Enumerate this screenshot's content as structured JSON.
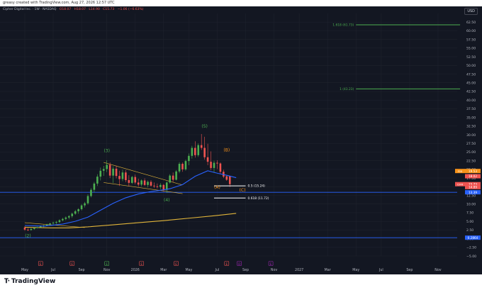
{
  "attribution": "greasy created with TradingView.com, Aug 27, 2026 12:57 UTC",
  "legend": {
    "symbol": "Cipher Digital Inc. · 1W · NASDAQ",
    "o": "O18.07",
    "h": "H18.07",
    "l": "L14.90",
    "c": "C15.73",
    "chg": "−1.06 (−6.63%)"
  },
  "currency": "USD",
  "brand": "TradingView",
  "colors": {
    "background": "#131722",
    "grid": "#1e222d",
    "up": "#26a69a",
    "up_green": "#4caf50",
    "down": "#ef5350",
    "ema_fast": "#2962ff",
    "ema_slow": "#e0b43a",
    "trendline": "#e0b43a",
    "fib_target": "#4caf50",
    "level_line": "#2962ff",
    "wave_impulse": "#4caf50",
    "wave_corrective": "#f7931a"
  },
  "chart_data": {
    "type": "candlestick",
    "y_axis": {
      "min": -5,
      "max": 65,
      "ticks": [
        -5,
        -2.5,
        0,
        2.5,
        5,
        7.5,
        10,
        12.5,
        15,
        17.5,
        20,
        22.5,
        25,
        27.5,
        30,
        32.5,
        35,
        37.5,
        40,
        42.5,
        45,
        47.5,
        50,
        52.5,
        55,
        57.5,
        60,
        62.5
      ],
      "tick_labels": [
        "−5.00",
        "−2.50",
        "0.00",
        "2.50",
        "5.00",
        "7.50",
        "10.00",
        "12.50",
        "15.00",
        "17.50",
        "20.00",
        "22.50",
        "25.00",
        "27.50",
        "30.00",
        "32.50",
        "35.00",
        "37.50",
        "40.00",
        "42.50",
        "45.00",
        "47.50",
        "50.00",
        "52.50",
        "55.00",
        "57.50",
        "60.00",
        "62.50"
      ],
      "scale": "linear",
      "position": "right"
    },
    "x_axis": {
      "ticks": [
        {
          "label": "May",
          "week": 0
        },
        {
          "label": "Jul",
          "week": 9
        },
        {
          "label": "Sep",
          "week": 18
        },
        {
          "label": "Nov",
          "week": 26
        },
        {
          "label": "2026",
          "week": 35
        },
        {
          "label": "Mar",
          "week": 44
        },
        {
          "label": "May",
          "week": 52
        },
        {
          "label": "Jul",
          "week": 61
        },
        {
          "label": "Sep",
          "week": 70
        },
        {
          "label": "Nov",
          "week": 79
        },
        {
          "label": "2027",
          "week": 87
        },
        {
          "label": "Mar",
          "week": 96
        },
        {
          "label": "May",
          "week": 105
        },
        {
          "label": "Jul",
          "week": 113
        },
        {
          "label": "Sep",
          "week": 122
        },
        {
          "label": "Nov",
          "week": 131
        }
      ]
    },
    "candles": [
      {
        "o": 3.2,
        "h": 3.6,
        "l": 2.3,
        "c": 2.6
      },
      {
        "o": 2.6,
        "h": 3.1,
        "l": 2.2,
        "c": 2.5
      },
      {
        "o": 2.5,
        "h": 3.0,
        "l": 2.3,
        "c": 2.8
      },
      {
        "o": 2.8,
        "h": 3.3,
        "l": 2.6,
        "c": 3.1
      },
      {
        "o": 3.1,
        "h": 3.5,
        "l": 2.9,
        "c": 3.3
      },
      {
        "o": 3.3,
        "h": 3.8,
        "l": 3.1,
        "c": 3.6
      },
      {
        "o": 3.6,
        "h": 4.0,
        "l": 3.3,
        "c": 3.8
      },
      {
        "o": 3.8,
        "h": 4.3,
        "l": 3.6,
        "c": 4.1
      },
      {
        "o": 4.1,
        "h": 4.6,
        "l": 3.8,
        "c": 4.4
      },
      {
        "o": 4.4,
        "h": 4.9,
        "l": 4.0,
        "c": 4.6
      },
      {
        "o": 4.6,
        "h": 5.1,
        "l": 4.2,
        "c": 4.8
      },
      {
        "o": 4.8,
        "h": 5.6,
        "l": 4.5,
        "c": 5.3
      },
      {
        "o": 5.3,
        "h": 6.0,
        "l": 5.0,
        "c": 5.7
      },
      {
        "o": 5.7,
        "h": 6.4,
        "l": 5.3,
        "c": 6.1
      },
      {
        "o": 6.1,
        "h": 6.8,
        "l": 5.6,
        "c": 6.5
      },
      {
        "o": 6.5,
        "h": 7.5,
        "l": 6.0,
        "c": 7.2
      },
      {
        "o": 7.2,
        "h": 8.3,
        "l": 6.9,
        "c": 7.9
      },
      {
        "o": 7.9,
        "h": 8.8,
        "l": 7.2,
        "c": 8.5
      },
      {
        "o": 8.5,
        "h": 10.0,
        "l": 8.1,
        "c": 9.6
      },
      {
        "o": 9.6,
        "h": 10.6,
        "l": 9.0,
        "c": 10.2
      },
      {
        "o": 10.2,
        "h": 12.8,
        "l": 9.8,
        "c": 12.3
      },
      {
        "o": 12.3,
        "h": 14.6,
        "l": 11.9,
        "c": 14.1
      },
      {
        "o": 14.1,
        "h": 16.4,
        "l": 13.4,
        "c": 15.9
      },
      {
        "o": 15.9,
        "h": 18.6,
        "l": 15.2,
        "c": 17.9
      },
      {
        "o": 17.9,
        "h": 20.5,
        "l": 16.8,
        "c": 19.6
      },
      {
        "o": 19.6,
        "h": 21.0,
        "l": 18.1,
        "c": 20.1
      },
      {
        "o": 20.1,
        "h": 22.6,
        "l": 19.2,
        "c": 21.3
      },
      {
        "o": 21.3,
        "h": 22.0,
        "l": 17.5,
        "c": 18.2
      },
      {
        "o": 18.2,
        "h": 20.9,
        "l": 16.0,
        "c": 20.2
      },
      {
        "o": 20.2,
        "h": 21.1,
        "l": 17.4,
        "c": 18.1
      },
      {
        "o": 18.1,
        "h": 19.6,
        "l": 15.2,
        "c": 17.2
      },
      {
        "o": 17.2,
        "h": 19.9,
        "l": 16.6,
        "c": 19.1
      },
      {
        "o": 19.1,
        "h": 19.8,
        "l": 16.3,
        "c": 16.9
      },
      {
        "o": 16.9,
        "h": 18.3,
        "l": 15.1,
        "c": 16.1
      },
      {
        "o": 16.1,
        "h": 18.1,
        "l": 15.8,
        "c": 17.8
      },
      {
        "o": 17.8,
        "h": 18.5,
        "l": 15.7,
        "c": 16.2
      },
      {
        "o": 16.2,
        "h": 17.3,
        "l": 15.0,
        "c": 15.6
      },
      {
        "o": 15.6,
        "h": 17.1,
        "l": 15.1,
        "c": 16.8
      },
      {
        "o": 16.8,
        "h": 17.4,
        "l": 15.2,
        "c": 15.5
      },
      {
        "o": 15.5,
        "h": 16.8,
        "l": 14.8,
        "c": 16.4
      },
      {
        "o": 16.4,
        "h": 16.9,
        "l": 15.0,
        "c": 15.3
      },
      {
        "o": 15.3,
        "h": 16.2,
        "l": 14.6,
        "c": 15.1
      },
      {
        "o": 15.1,
        "h": 15.9,
        "l": 14.5,
        "c": 14.9
      },
      {
        "o": 14.9,
        "h": 16.0,
        "l": 14.3,
        "c": 15.5
      },
      {
        "o": 15.5,
        "h": 15.8,
        "l": 13.6,
        "c": 14.1
      },
      {
        "o": 14.1,
        "h": 16.5,
        "l": 13.2,
        "c": 16.2
      },
      {
        "o": 16.2,
        "h": 18.6,
        "l": 15.9,
        "c": 18.2
      },
      {
        "o": 18.2,
        "h": 19.1,
        "l": 16.4,
        "c": 17.0
      },
      {
        "o": 17.0,
        "h": 19.8,
        "l": 16.8,
        "c": 19.4
      },
      {
        "o": 19.4,
        "h": 22.1,
        "l": 18.9,
        "c": 21.6
      },
      {
        "o": 21.6,
        "h": 22.0,
        "l": 19.3,
        "c": 20.0
      },
      {
        "o": 20.0,
        "h": 22.8,
        "l": 19.6,
        "c": 22.4
      },
      {
        "o": 22.4,
        "h": 24.6,
        "l": 21.2,
        "c": 23.9
      },
      {
        "o": 23.9,
        "h": 26.8,
        "l": 23.1,
        "c": 26.2
      },
      {
        "o": 26.2,
        "h": 28.1,
        "l": 23.4,
        "c": 24.1
      },
      {
        "o": 24.1,
        "h": 27.5,
        "l": 23.6,
        "c": 27.0
      },
      {
        "o": 27.0,
        "h": 30.2,
        "l": 25.6,
        "c": 26.2
      },
      {
        "o": 26.2,
        "h": 29.4,
        "l": 22.8,
        "c": 23.5
      },
      {
        "o": 23.5,
        "h": 27.4,
        "l": 21.2,
        "c": 22.2
      },
      {
        "o": 22.2,
        "h": 25.2,
        "l": 19.8,
        "c": 20.4
      },
      {
        "o": 20.4,
        "h": 22.5,
        "l": 19.0,
        "c": 21.9
      },
      {
        "o": 21.9,
        "h": 22.6,
        "l": 20.1,
        "c": 21.7
      },
      {
        "o": 21.7,
        "h": 22.0,
        "l": 18.8,
        "c": 19.3
      },
      {
        "o": 19.3,
        "h": 19.9,
        "l": 17.5,
        "c": 17.9
      },
      {
        "o": 18.0,
        "h": 18.2,
        "l": 16.7,
        "c": 17.0
      },
      {
        "o": 18.07,
        "h": 18.07,
        "l": 14.9,
        "c": 15.73
      }
    ],
    "ema_fast": {
      "name": "",
      "values": [
        [
          0,
          3.8
        ],
        [
          6,
          3.6
        ],
        [
          12,
          4.2
        ],
        [
          16,
          5.0
        ],
        [
          20,
          6.2
        ],
        [
          24,
          8.2
        ],
        [
          28,
          10.2
        ],
        [
          32,
          11.8
        ],
        [
          36,
          12.9
        ],
        [
          40,
          13.6
        ],
        [
          44,
          14.1
        ],
        [
          46,
          14.4
        ],
        [
          50,
          15.6
        ],
        [
          54,
          18.0
        ],
        [
          58,
          19.6
        ],
        [
          61,
          18.9
        ],
        [
          64,
          18.3
        ],
        [
          67,
          17.6
        ]
      ]
    },
    "ema_slow": {
      "name": "",
      "values": [
        [
          0,
          3.3
        ],
        [
          8,
          3.1
        ],
        [
          14,
          3.1
        ],
        [
          20,
          3.4
        ],
        [
          28,
          4.0
        ],
        [
          36,
          4.6
        ],
        [
          44,
          5.2
        ],
        [
          52,
          5.9
        ],
        [
          60,
          6.6
        ],
        [
          67,
          7.3
        ]
      ]
    },
    "trendlines": [
      {
        "from": [
          0,
          4.6
        ],
        "to": [
          19,
          3.2
        ]
      },
      {
        "from": [
          25,
          22.0
        ],
        "to": [
          50,
          15.5
        ]
      },
      {
        "from": [
          25,
          16.2
        ],
        "to": [
          50,
          13.0
        ]
      }
    ],
    "fib_levels": [
      {
        "label": "0.5 (15.24)",
        "value": 15.24,
        "from_week": 60,
        "to_week": 70,
        "color": "#ffffff"
      },
      {
        "label": "0.618 (11.72)",
        "value": 11.72,
        "from_week": 60,
        "to_week": 70,
        "color": "#ffffff"
      },
      {
        "label": "1 (43.23)",
        "value": 43.23,
        "from_week": 105,
        "to_week": 138,
        "color": "#4caf50"
      },
      {
        "label": "1.618 (61.73)",
        "value": 61.73,
        "from_week": 105,
        "to_week": 138,
        "color": "#4caf50"
      }
    ],
    "horizontal_levels": [
      {
        "value": 13.39,
        "label": "13.39",
        "color": "#2962ff"
      },
      {
        "value": 0.2864,
        "label": "0.2864",
        "color": "#2962ff"
      }
    ],
    "wave_labels": [
      {
        "text": "(2)",
        "week": 1,
        "value": 0.4,
        "color": "#4caf50"
      },
      {
        "text": "(3)",
        "week": 26,
        "value": 25.0,
        "color": "#4caf50"
      },
      {
        "text": "(4)",
        "week": 45,
        "value": 10.8,
        "color": "#4caf50"
      },
      {
        "text": "(5)",
        "week": 57,
        "value": 32.0,
        "color": "#4caf50"
      },
      {
        "text": "(A)",
        "week": 61,
        "value": 14.4,
        "color": "#f7931a"
      },
      {
        "text": "(B)",
        "week": 64,
        "value": 25.2,
        "color": "#f7931a"
      },
      {
        "text": "(C)",
        "week": 69,
        "value": 13.6,
        "color": "#f7931a"
      }
    ],
    "price_tags": [
      {
        "label": "19.53",
        "value": 19.53,
        "color": "#f7931a",
        "prefix": "FIB"
      },
      {
        "label": "18.02",
        "value": 18.02,
        "color": "#ef5350",
        "prefix": ""
      },
      {
        "label": "15.73",
        "value": 15.73,
        "color": "#ef5350",
        "prefix": "CIFR"
      },
      {
        "label": "14.89",
        "value": 14.89,
        "color": "#ef5350",
        "prefix": ""
      },
      {
        "label": "13.39",
        "value": 13.39,
        "color": "#2962ff",
        "prefix": ""
      },
      {
        "label": "0.2864",
        "value": 0.2864,
        "color": "#2962ff",
        "prefix": ""
      }
    ],
    "event_markers": [
      {
        "week": 5,
        "letter": "E",
        "color": "#ef5350"
      },
      {
        "week": 15,
        "letter": "E",
        "color": "#ef5350"
      },
      {
        "week": 26,
        "letter": "E",
        "color": "#4caf50"
      },
      {
        "week": 37,
        "letter": "E",
        "color": "#ef5350"
      },
      {
        "week": 48,
        "letter": "E",
        "color": "#ef5350"
      },
      {
        "week": 64,
        "letter": "E",
        "color": "#ef5350"
      },
      {
        "week": 68,
        "letter": "D",
        "color": "#9c27b0"
      },
      {
        "week": 78,
        "letter": "E",
        "color": "#9c27b0"
      }
    ]
  }
}
